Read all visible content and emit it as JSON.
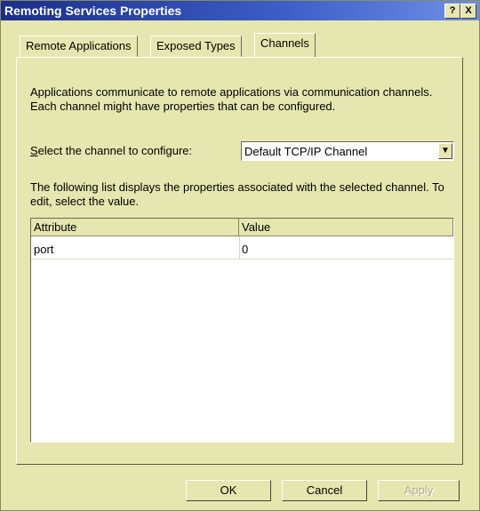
{
  "window": {
    "title": "Remoting Services Properties",
    "help_button": "?",
    "close_button": "X"
  },
  "tabs": [
    {
      "label": "Remote Applications"
    },
    {
      "label": "Exposed Types"
    },
    {
      "label": "Channels"
    }
  ],
  "intro_text": "Applications communicate to remote applications via communication channels.  Each channel might have properties that can be configured.",
  "channel_select": {
    "label_mnemonic": "S",
    "label_rest": "elect the channel to configure:",
    "value": "Default TCP/IP Channel"
  },
  "list_description": "The following list displays the properties associated with the selected channel.  To edit, select the value.",
  "property_table": {
    "columns": [
      "Attribute",
      "Value"
    ],
    "rows": [
      {
        "attribute": "port",
        "value": "0"
      }
    ]
  },
  "buttons": {
    "ok": "OK",
    "cancel": "Cancel",
    "apply": "Apply"
  }
}
